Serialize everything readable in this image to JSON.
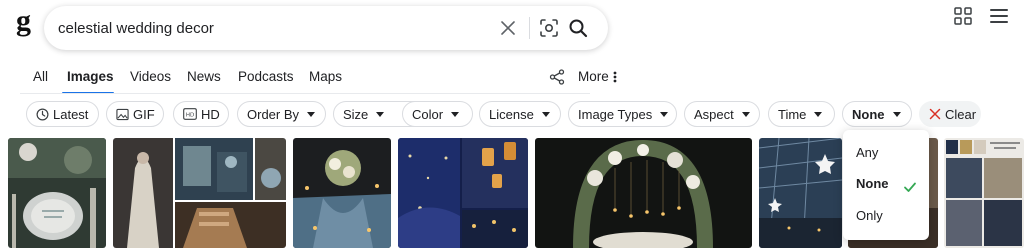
{
  "brand": {
    "logo_text": "g"
  },
  "search": {
    "query": "celestial wedding decor"
  },
  "tabs": [
    {
      "label": "All"
    },
    {
      "label": "Images"
    },
    {
      "label": "Videos"
    },
    {
      "label": "News"
    },
    {
      "label": "Podcasts"
    },
    {
      "label": "Maps"
    }
  ],
  "more_label": "More",
  "filters": [
    {
      "label": "Latest",
      "icon": "clock-icon"
    },
    {
      "label": "GIF",
      "icon": "image-icon"
    },
    {
      "label": "HD",
      "icon": "hd-icon"
    },
    {
      "label": "Order By"
    },
    {
      "label": "Size"
    },
    {
      "label": "Color"
    },
    {
      "label": "License"
    },
    {
      "label": "Image Types"
    },
    {
      "label": "Aspect"
    },
    {
      "label": "Time"
    },
    {
      "label": "None"
    },
    {
      "label": "Clear",
      "icon": "close-icon"
    }
  ],
  "dropdown": {
    "options": [
      "Any",
      "None",
      "Only"
    ],
    "selected": "None"
  },
  "colors": {
    "accent": "#1a73e8",
    "check": "#34a853",
    "clear_x": "#d93025"
  }
}
